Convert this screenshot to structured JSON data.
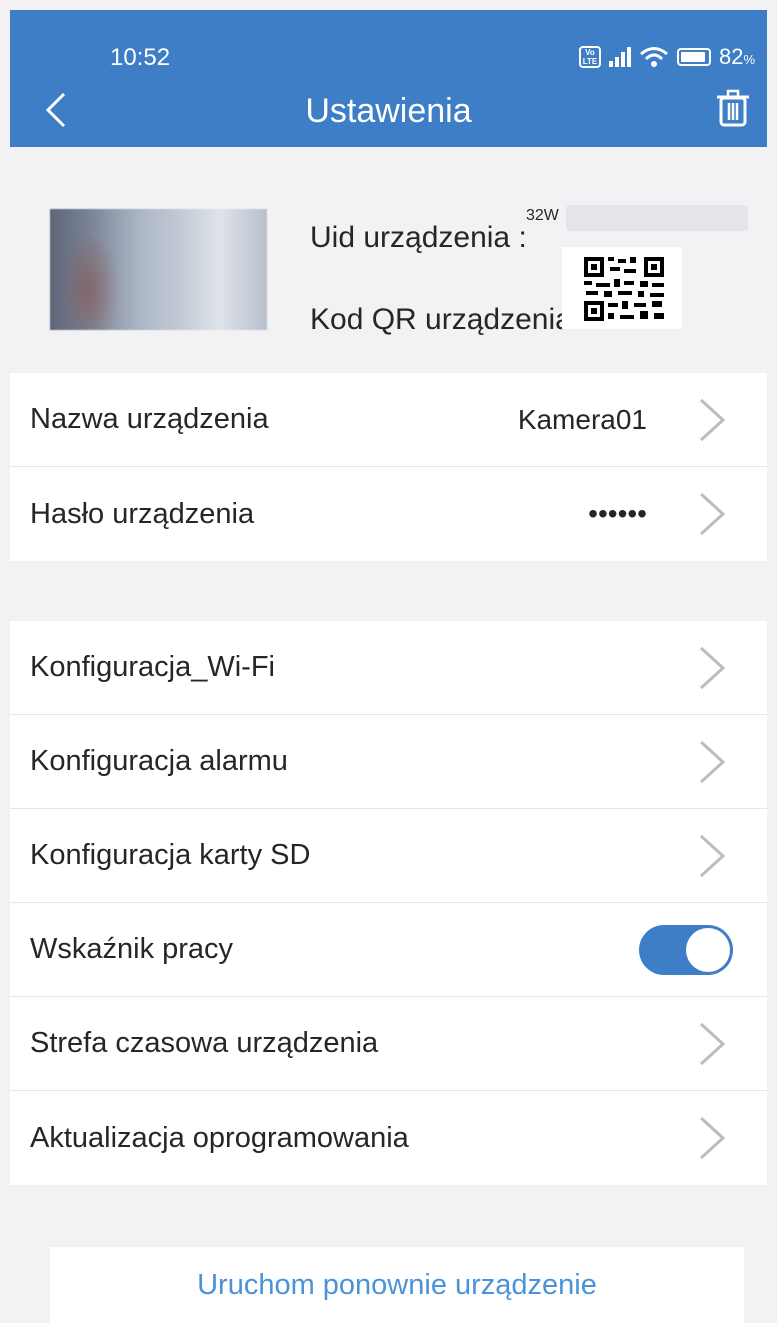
{
  "status_bar": {
    "time": "10:52",
    "battery": "82",
    "battery_unit": "%",
    "network": "Vo LTE"
  },
  "header": {
    "title": "Ustawienia"
  },
  "device": {
    "uid_label": "Uid urządzenia :",
    "uid_value": "32W",
    "qr_label": "Kod QR urządzenia:"
  },
  "group1": [
    {
      "label": "Nazwa urządzenia",
      "value": "Kamera01"
    },
    {
      "label": "Hasło urządzenia",
      "value": "••••••"
    }
  ],
  "group2": [
    {
      "label": "Konfiguracja_Wi-Fi"
    },
    {
      "label": "Konfiguracja alarmu"
    },
    {
      "label": "Konfiguracja karty SD"
    },
    {
      "label": "Wskaźnik pracy",
      "toggle_on": true
    },
    {
      "label": "Strefa czasowa urządzenia"
    },
    {
      "label": "Aktualizacja oprogramowania"
    }
  ],
  "restart_label": "Uruchom ponownie urządzenie",
  "colors": {
    "accent": "#3d7ec6",
    "link": "#4b93d8",
    "background": "#f2f2f4"
  }
}
